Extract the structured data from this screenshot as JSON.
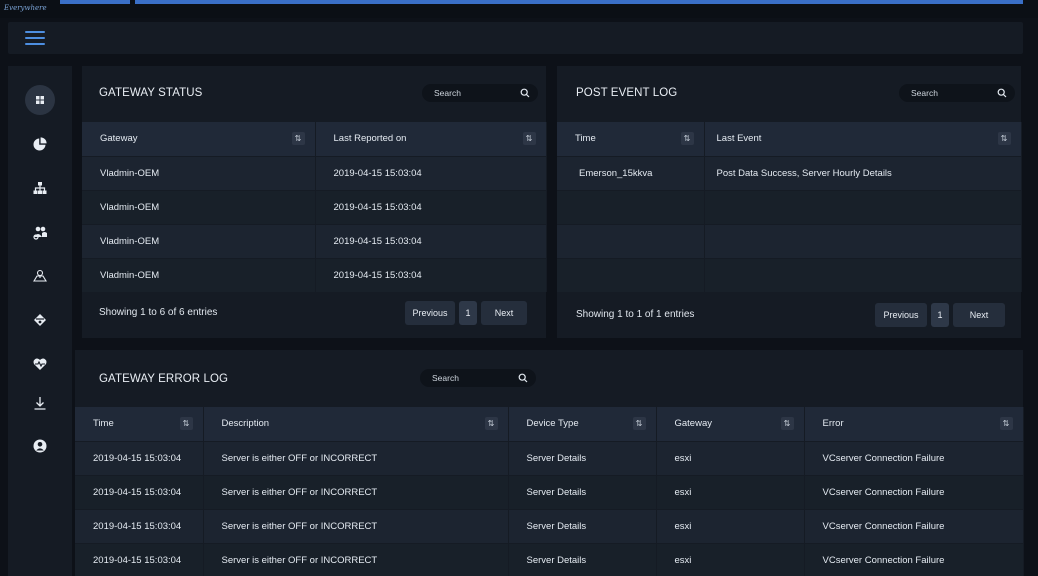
{
  "app": {
    "logo_text": "Everywhere"
  },
  "sidebar": {
    "items": [
      {
        "name": "dashboard-icon"
      },
      {
        "name": "pie-chart-icon"
      },
      {
        "name": "hierarchy-icon"
      },
      {
        "name": "users-cog-icon"
      },
      {
        "name": "map-icon"
      },
      {
        "name": "balance-icon"
      },
      {
        "name": "heartbeat-icon"
      },
      {
        "name": "download-icon"
      },
      {
        "name": "user-circle-icon"
      }
    ]
  },
  "gateway_status": {
    "title": "GATEWAY STATUS",
    "search_placeholder": "Search",
    "columns": [
      "Gateway",
      "Last Reported on"
    ],
    "rows": [
      [
        "Vladmin-OEM",
        "2019-04-15  15:03:04"
      ],
      [
        "Vladmin-OEM",
        "2019-04-15  15:03:04"
      ],
      [
        "Vladmin-OEM",
        "2019-04-15  15:03:04"
      ],
      [
        "Vladmin-OEM",
        "2019-04-15  15:03:04"
      ]
    ],
    "footer": "Showing 1 to 6 of 6 entries",
    "pagination": {
      "previous": "Previous",
      "page": "1",
      "next": "Next"
    }
  },
  "post_event_log": {
    "title": "POST EVENT LOG",
    "search_placeholder": "Search",
    "columns": [
      "Time",
      "Last Event"
    ],
    "rows": [
      [
        "Emerson_15kkva",
        "Post Data Success, Server Hourly Details"
      ],
      [
        "",
        ""
      ],
      [
        "",
        ""
      ],
      [
        "",
        ""
      ]
    ],
    "footer": "Showing 1 to 1 of 1 entries",
    "pagination": {
      "previous": "Previous",
      "page": "1",
      "next": "Next"
    }
  },
  "gateway_error_log": {
    "title": "GATEWAY ERROR LOG",
    "search_placeholder": "Search",
    "columns": [
      "Time",
      "Description",
      "Device Type",
      "Gateway",
      "Error"
    ],
    "rows": [
      [
        "2019-04-15  15:03:04",
        "Server is either OFF or INCORRECT",
        "Server Details",
        "esxi",
        "VCserver Connection Failure"
      ],
      [
        "2019-04-15  15:03:04",
        "Server is either OFF or INCORRECT",
        "Server Details",
        "esxi",
        "VCserver Connection Failure"
      ],
      [
        "2019-04-15  15:03:04",
        "Server is either OFF or INCORRECT",
        "Server Details",
        "esxi",
        "VCserver Connection Failure"
      ],
      [
        "2019-04-15  15:03:04",
        "Server is either OFF or INCORRECT",
        "Server Details",
        "esxi",
        "VCserver Connection Failure"
      ]
    ]
  },
  "colors": {
    "background": "#0d1118",
    "panel": "#151b24",
    "header_row": "#202938",
    "accent": "#3a6fc7"
  }
}
